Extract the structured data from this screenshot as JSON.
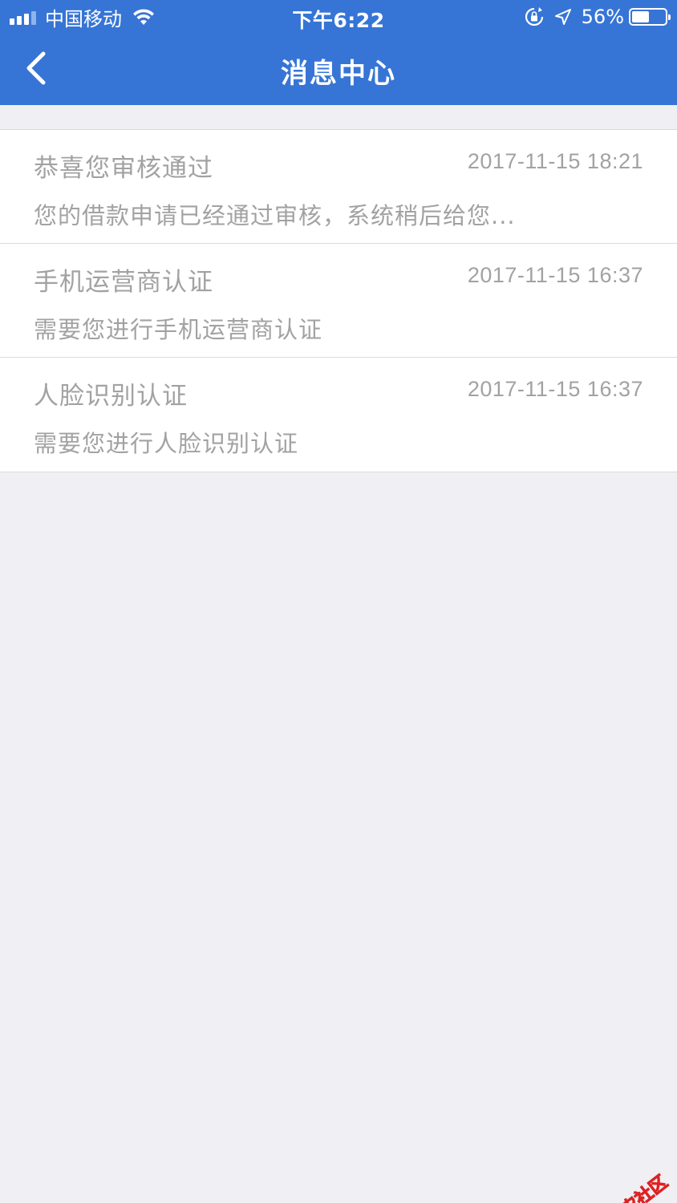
{
  "status_bar": {
    "carrier": "中国移动",
    "time": "下午6:22",
    "battery_percent": "56%",
    "battery_level": 0.56
  },
  "nav": {
    "title": "消息中心"
  },
  "messages": [
    {
      "title": "恭喜您审核通过",
      "time": "2017-11-15 18:21",
      "body": "您的借款申请已经通过审核，系统稍后给您..."
    },
    {
      "title": "手机运营商认证",
      "time": "2017-11-15 16:37",
      "body": "需要您进行手机运营商认证"
    },
    {
      "title": "人脸识别认证",
      "time": "2017-11-15 16:37",
      "body": "需要您进行人脸识别认证"
    }
  ],
  "watermark": {
    "text": "卡农社区"
  },
  "colors": {
    "header": "#3675d6",
    "background": "#efeff4",
    "text_muted": "#a2a2a2"
  }
}
